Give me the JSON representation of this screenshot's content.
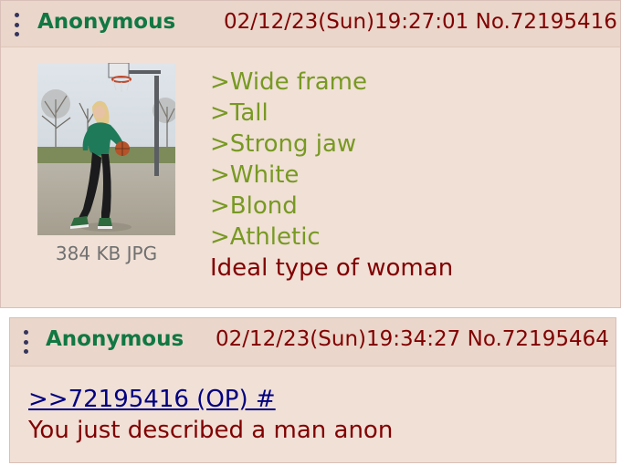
{
  "op_post": {
    "name": "Anonymous",
    "datetime": "02/12/23(Sun)19:27:01",
    "post_number": "No.72195416",
    "file_info": "384 KB JPG",
    "lines": [
      {
        "kind": "greentext",
        "text": ">Wide frame"
      },
      {
        "kind": "greentext",
        "text": ">Tall"
      },
      {
        "kind": "greentext",
        "text": ">Strong jaw"
      },
      {
        "kind": "greentext",
        "text": ">White"
      },
      {
        "kind": "greentext",
        "text": ">Blond"
      },
      {
        "kind": "greentext",
        "text": ">Athletic"
      },
      {
        "kind": "plain",
        "text": "Ideal type of woman"
      }
    ]
  },
  "reply_post": {
    "name": "Anonymous",
    "datetime": "02/12/23(Sun)19:34:27",
    "post_number": "No.72195464",
    "quote_link": ">>72195416 (OP) #",
    "message": "You just described a man anon"
  },
  "colors": {
    "post_bg": "#f0e0d6",
    "header_bg": "#ead6ca",
    "name": "#117743",
    "text": "#800000",
    "greentext": "#789922",
    "link": "#000080",
    "file_info": "#707070"
  },
  "icons": {
    "post_menu": "vertical-ellipsis-icon",
    "thumbnail": "photo-thumbnail"
  }
}
